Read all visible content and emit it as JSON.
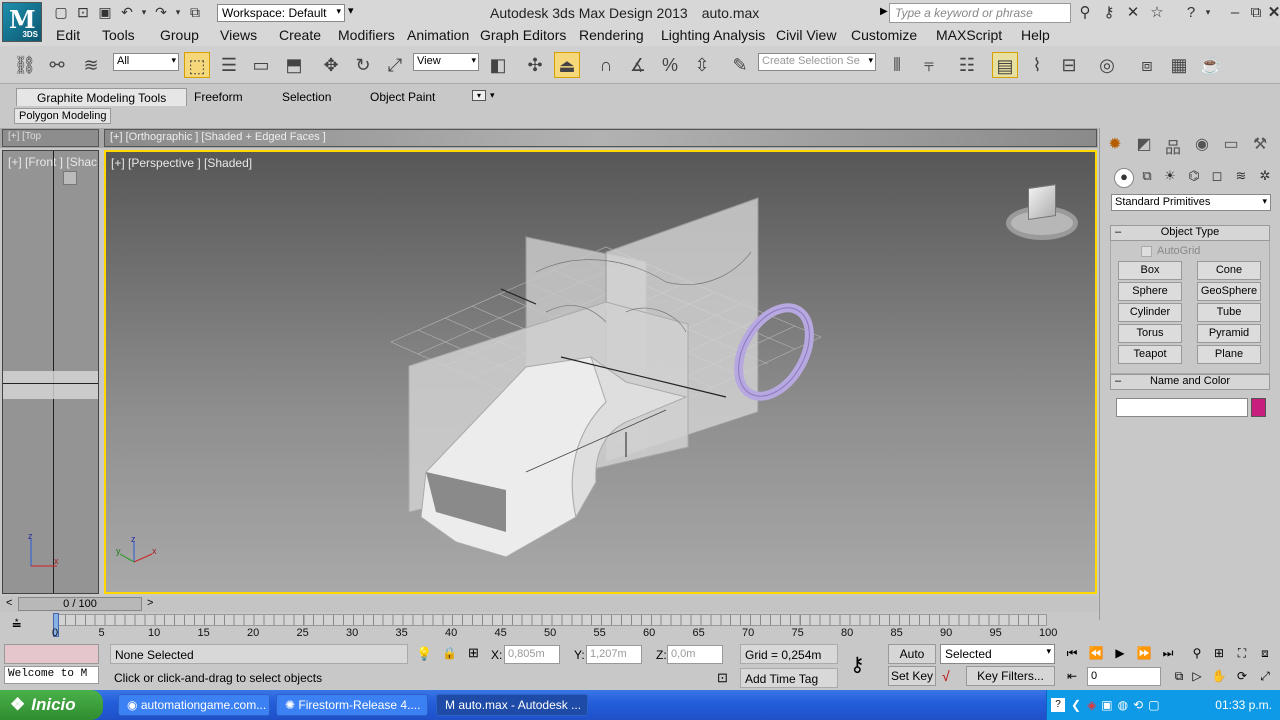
{
  "app": {
    "logo_text": "3DS",
    "title": "Autodesk 3ds Max Design 2013",
    "file": "auto.max"
  },
  "workspace": {
    "label": "Workspace: Default"
  },
  "search": {
    "placeholder": "Type a keyword or phrase"
  },
  "menu": [
    "Edit",
    "Tools",
    "Group",
    "Views",
    "Create",
    "Modifiers",
    "Animation",
    "Graph Editors",
    "Rendering",
    "Lighting Analysis",
    "Civil View",
    "Customize",
    "MAXScript",
    "Help"
  ],
  "toolbar": {
    "filter": "All",
    "ref_coord": "View",
    "selection_set_placeholder": "Create Selection Se"
  },
  "ribbon": {
    "tabs": [
      "Graphite Modeling Tools",
      "Freeform",
      "Selection",
      "Object Paint"
    ],
    "panel": "Polygon Modeling"
  },
  "viewports": {
    "front": "[+] [Front ] [Shac",
    "ortho": "[+] [Orthographic ] [Shaded + Edged Faces ]",
    "perspective": "[+] [Perspective ] [Shaded]"
  },
  "command_panel": {
    "dropdown": "Standard Primitives",
    "object_type": {
      "title": "Object Type",
      "autogrid": "AutoGrid",
      "buttons": [
        "Box",
        "Cone",
        "Sphere",
        "GeoSphere",
        "Cylinder",
        "Tube",
        "Torus",
        "Pyramid",
        "Teapot",
        "Plane"
      ]
    },
    "name_color": {
      "title": "Name and Color",
      "name_value": "",
      "color": "#c81f7e"
    }
  },
  "timeslider": {
    "value": "0 / 100",
    "ticks": [
      "0",
      "5",
      "10",
      "15",
      "20",
      "25",
      "30",
      "35",
      "40",
      "45",
      "50",
      "55",
      "60",
      "65",
      "70",
      "75",
      "80",
      "85",
      "90",
      "95",
      "100"
    ]
  },
  "status": {
    "maxscript_mini": "Welcome to M",
    "selection": "None Selected",
    "prompt": "Click or click-and-drag to select objects",
    "x": "0,805m",
    "y": "1,207m",
    "z": "0,0m",
    "grid": "Grid = 0,254m",
    "add_time_tag": "Add Time Tag",
    "auto_key": "Auto Key",
    "set_key": "Set Key",
    "key_mode": "Selected",
    "key_filters": "Key Filters...",
    "frame": "0"
  },
  "taskbar": {
    "start": "Inicio",
    "tasks": [
      "automationgame.com...",
      "Firestorm-Release 4....",
      "auto.max - Autodesk ..."
    ],
    "clock": "01:33 p.m."
  }
}
